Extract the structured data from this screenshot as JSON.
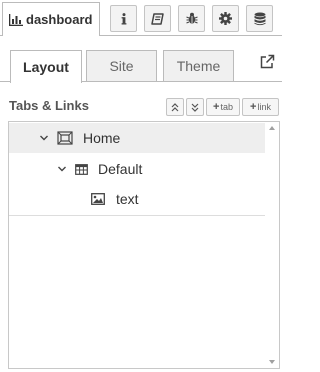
{
  "sidebar_tab": {
    "label": "dashboard",
    "icon": "bar-chart-icon"
  },
  "toolbar": {
    "buttons": [
      {
        "name": "info",
        "icon": "info-icon"
      },
      {
        "name": "help",
        "icon": "book-icon"
      },
      {
        "name": "debug",
        "icon": "bug-icon"
      },
      {
        "name": "config",
        "icon": "gear-icon"
      },
      {
        "name": "context",
        "icon": "database-icon"
      }
    ]
  },
  "subtabs": [
    {
      "label": "Layout",
      "active": true
    },
    {
      "label": "Site",
      "active": false
    },
    {
      "label": "Theme",
      "active": false
    }
  ],
  "section": {
    "title": "Tabs & Links",
    "add_tab_label": "tab",
    "add_link_label": "link"
  },
  "tree": [
    {
      "label": "Home",
      "type": "tab",
      "expanded": true,
      "level": 0
    },
    {
      "label": "Default",
      "type": "group",
      "expanded": true,
      "level": 1
    },
    {
      "label": "text",
      "type": "widget",
      "level": 2
    }
  ],
  "colors": {
    "border": "#bbbbbb",
    "selected_row": "#eeeeee",
    "button_bg": "#f3f3f3",
    "text": "#333333"
  }
}
